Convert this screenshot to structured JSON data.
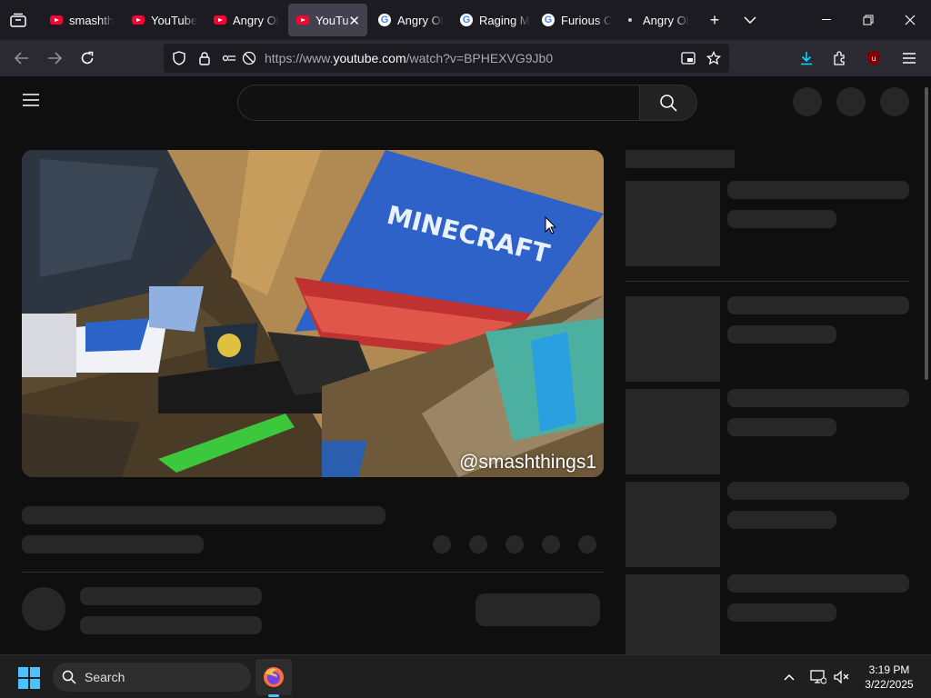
{
  "browser": {
    "tabs": [
      {
        "title": "smashth",
        "favicon": "youtube-favicon",
        "active": false
      },
      {
        "title": "YouTube",
        "favicon": "youtube-favicon",
        "active": false
      },
      {
        "title": "Angry Ol",
        "favicon": "youtube-favicon",
        "active": false
      },
      {
        "title": "YouTu",
        "favicon": "youtube-favicon",
        "active": true
      },
      {
        "title": "Angry Ol",
        "favicon": "google-favicon",
        "active": false
      },
      {
        "title": "Raging M",
        "favicon": "google-favicon",
        "active": false
      },
      {
        "title": "Furious C",
        "favicon": "google-favicon",
        "active": false
      },
      {
        "title": "Angry Ol",
        "favicon": "loading-dot",
        "active": false
      }
    ],
    "url_prefix": "https://www.",
    "url_domain": "youtube.com",
    "url_path": "/watch?v=BPHEXVG9Jb0",
    "extension_badge": "11",
    "colors": {
      "tabstrip": "#1c1b22",
      "navbar": "#2b2a33",
      "active_tab": "#42414d",
      "download_accent": "#00ddff"
    }
  },
  "youtube": {
    "video_watermark": "@smashthings1",
    "video_scene_text": "MINECRAFT"
  },
  "taskbar": {
    "search_label": "Search",
    "time": "3:19 PM",
    "date": "3/22/2025",
    "accent": "#4cc2ff"
  }
}
